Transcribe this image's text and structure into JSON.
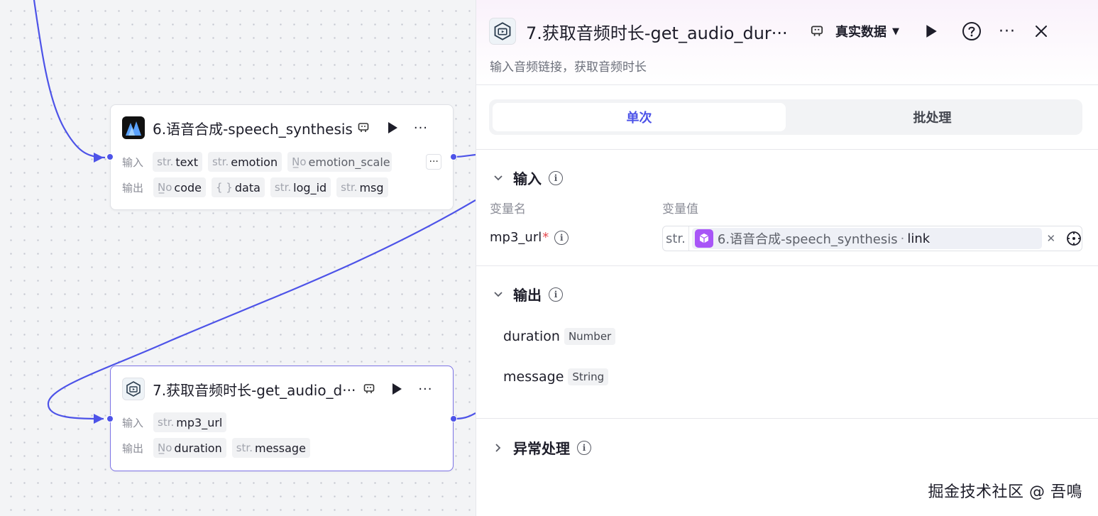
{
  "canvas": {
    "node6": {
      "title": "6.语音合成-speech_synthesis",
      "input_label": "输入",
      "output_label": "输出",
      "inputs": [
        {
          "type": "str.",
          "name": "text"
        },
        {
          "type": "str.",
          "name": "emotion"
        },
        {
          "type": "N̲o",
          "name": "emotion_scale"
        }
      ],
      "outputs": [
        {
          "type": "N̲o",
          "name": "code"
        },
        {
          "type": "{ }",
          "name": "data"
        },
        {
          "type": "str.",
          "name": "log_id"
        },
        {
          "type": "str.",
          "name": "msg"
        }
      ],
      "more_label": "···"
    },
    "node7": {
      "title": "7.获取音频时长-get_audio_d···",
      "input_label": "输入",
      "output_label": "输出",
      "inputs": [
        {
          "type": "str.",
          "name": "mp3_url"
        }
      ],
      "outputs": [
        {
          "type": "N̲o",
          "name": "duration"
        },
        {
          "type": "str.",
          "name": "message"
        }
      ]
    },
    "edge_color": "#4d53e8"
  },
  "panel": {
    "title": "7.获取音频时长-get_audio_dur···",
    "mode_select": "真实数据",
    "description": "输入音频链接，获取音频时长",
    "tabs": [
      {
        "label": "单次",
        "active": true
      },
      {
        "label": "批处理",
        "active": false
      }
    ],
    "input_section": {
      "title": "输入",
      "col_name": "变量名",
      "col_value": "变量值",
      "var_name": "mp3_url",
      "required_mark": "*",
      "var_type": "str.",
      "ref_source": "6.语音合成-speech_synthesis",
      "ref_sep": "·",
      "ref_field": "link"
    },
    "output_section": {
      "title": "输出",
      "fields": [
        {
          "name": "duration",
          "type": "Number"
        },
        {
          "name": "message",
          "type": "String"
        }
      ]
    },
    "error_section": {
      "title": "异常处理"
    }
  },
  "watermark": "掘金技术社区 @ 吾鳴",
  "colors": {
    "accent": "#4d53e8",
    "required": "#e5484d",
    "cube": "#a855f7"
  }
}
